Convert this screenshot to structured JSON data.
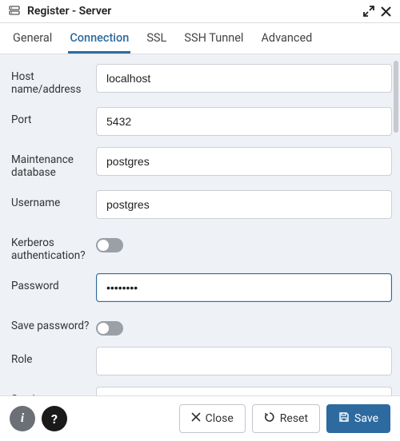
{
  "window": {
    "title": "Register - Server"
  },
  "tabs": {
    "general": "General",
    "connection": "Connection",
    "ssl": "SSL",
    "ssh_tunnel": "SSH Tunnel",
    "advanced": "Advanced",
    "active": "connection"
  },
  "form": {
    "host": {
      "label": "Host name/address",
      "value": "localhost"
    },
    "port": {
      "label": "Port",
      "value": "5432"
    },
    "maintenance_db": {
      "label": "Maintenance database",
      "value": "postgres"
    },
    "username": {
      "label": "Username",
      "value": "postgres"
    },
    "kerberos": {
      "label": "Kerberos authentication?",
      "value": false
    },
    "password": {
      "label": "Password",
      "value": "••••••••"
    },
    "save_password": {
      "label": "Save password?",
      "value": false
    },
    "role": {
      "label": "Role",
      "value": ""
    },
    "service": {
      "label": "Service",
      "value": ""
    }
  },
  "footer": {
    "info_tooltip": "i",
    "help_tooltip": "?",
    "close": "Close",
    "reset": "Reset",
    "save": "Save"
  }
}
